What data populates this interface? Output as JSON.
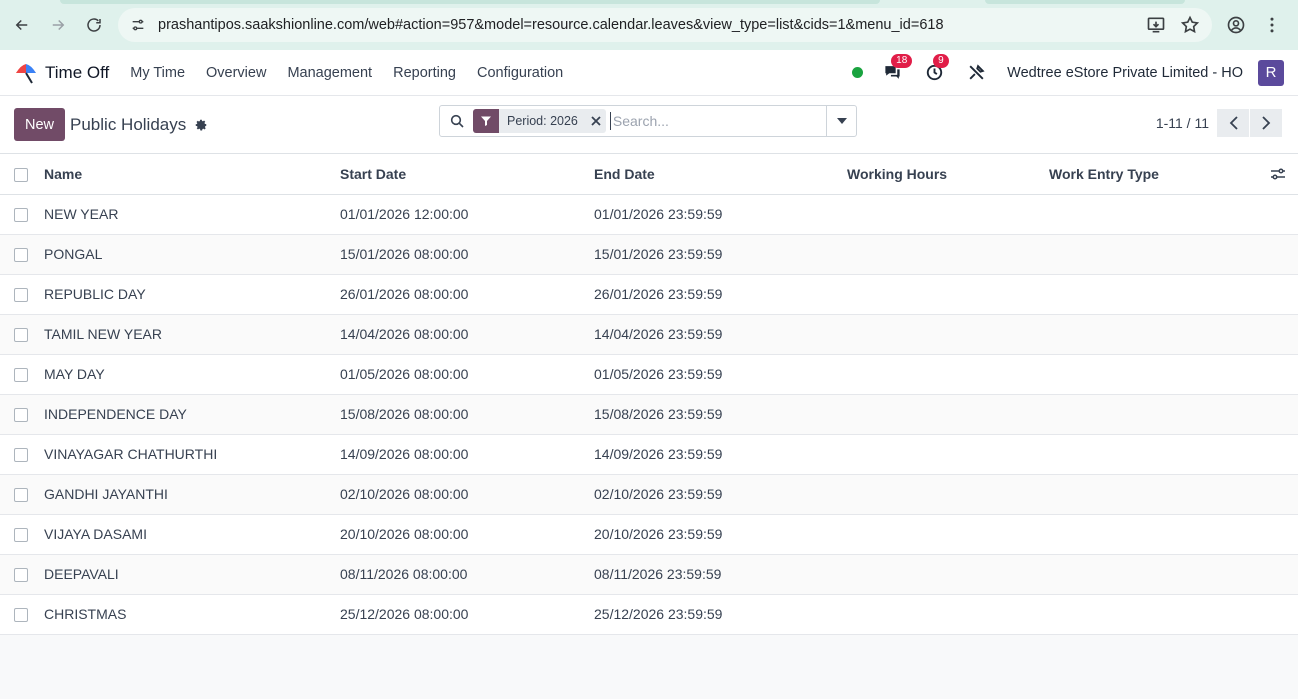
{
  "browser": {
    "url": "prashantipos.saakshionline.com/web#action=957&model=resource.calendar.leaves&view_type=list&cids=1&menu_id=618"
  },
  "navbar": {
    "app_name": "Time Off",
    "menu": [
      "My Time",
      "Overview",
      "Management",
      "Reporting",
      "Configuration"
    ],
    "messages_count": "18",
    "activities_count": "9",
    "company": "Wedtree eStore Private Limited - HO",
    "avatar_initial": "R",
    "colors": {
      "brand": "#714b67",
      "badge": "#e11d48",
      "presence": "#1aa33f",
      "avatar": "#5b4a9c"
    }
  },
  "control_panel": {
    "new_label": "New",
    "title": "Public Holidays",
    "facet_label": "Period: 2026",
    "search_placeholder": "Search...",
    "pager": "1-11 / 11"
  },
  "list": {
    "columns": [
      "Name",
      "Start Date",
      "End Date",
      "Working Hours",
      "Work Entry Type"
    ],
    "rows": [
      {
        "name": "NEW YEAR",
        "start": "01/01/2026 12:00:00",
        "end": "01/01/2026 23:59:59",
        "hours": "",
        "type": ""
      },
      {
        "name": "PONGAL",
        "start": "15/01/2026 08:00:00",
        "end": "15/01/2026 23:59:59",
        "hours": "",
        "type": ""
      },
      {
        "name": "REPUBLIC DAY",
        "start": "26/01/2026 08:00:00",
        "end": "26/01/2026 23:59:59",
        "hours": "",
        "type": ""
      },
      {
        "name": "TAMIL NEW YEAR",
        "start": "14/04/2026 08:00:00",
        "end": "14/04/2026 23:59:59",
        "hours": "",
        "type": ""
      },
      {
        "name": "MAY DAY",
        "start": "01/05/2026 08:00:00",
        "end": "01/05/2026 23:59:59",
        "hours": "",
        "type": ""
      },
      {
        "name": "INDEPENDENCE DAY",
        "start": "15/08/2026 08:00:00",
        "end": "15/08/2026 23:59:59",
        "hours": "",
        "type": ""
      },
      {
        "name": "VINAYAGAR CHATHURTHI",
        "start": "14/09/2026 08:00:00",
        "end": "14/09/2026 23:59:59",
        "hours": "",
        "type": ""
      },
      {
        "name": "GANDHI JAYANTHI",
        "start": "02/10/2026 08:00:00",
        "end": "02/10/2026 23:59:59",
        "hours": "",
        "type": ""
      },
      {
        "name": "VIJAYA DASAMI",
        "start": "20/10/2026 08:00:00",
        "end": "20/10/2026 23:59:59",
        "hours": "",
        "type": ""
      },
      {
        "name": "DEEPAVALI",
        "start": "08/11/2026 08:00:00",
        "end": "08/11/2026 23:59:59",
        "hours": "",
        "type": ""
      },
      {
        "name": "CHRISTMAS",
        "start": "25/12/2026 08:00:00",
        "end": "25/12/2026 23:59:59",
        "hours": "",
        "type": ""
      }
    ]
  }
}
